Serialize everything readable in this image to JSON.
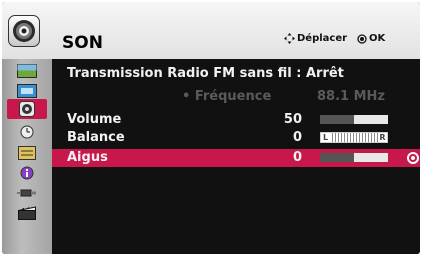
{
  "header": {
    "title": "SON",
    "icon": "speaker-icon",
    "hint_move": "Déplacer",
    "hint_ok": "OK"
  },
  "sidebar": {
    "items": [
      {
        "icon": "picture-icon",
        "active": false
      },
      {
        "icon": "screen-icon",
        "active": false
      },
      {
        "icon": "sound-icon",
        "active": true
      },
      {
        "icon": "clock-icon",
        "active": false
      },
      {
        "icon": "options-icon",
        "active": false
      },
      {
        "icon": "info-icon",
        "active": false
      },
      {
        "icon": "input-icon",
        "active": false
      },
      {
        "icon": "media-icon",
        "active": false
      }
    ]
  },
  "menu": {
    "fm_line": "Transmission Radio FM sans fil : Arrêt",
    "frequency": {
      "label": "• Fréquence",
      "value": "88.1 MHz"
    },
    "volume": {
      "label": "Volume",
      "value": "50",
      "level": 0.5
    },
    "balance": {
      "label": "Balance",
      "value": "0",
      "left": "L",
      "right": "R"
    },
    "aigus": {
      "label": "Aigus",
      "value": "0",
      "level": 0.5
    }
  },
  "colors": {
    "accent": "#c8174a",
    "panel": "#111111",
    "header": "#e8e8e8",
    "disabled_text": "#5a5a5a"
  }
}
